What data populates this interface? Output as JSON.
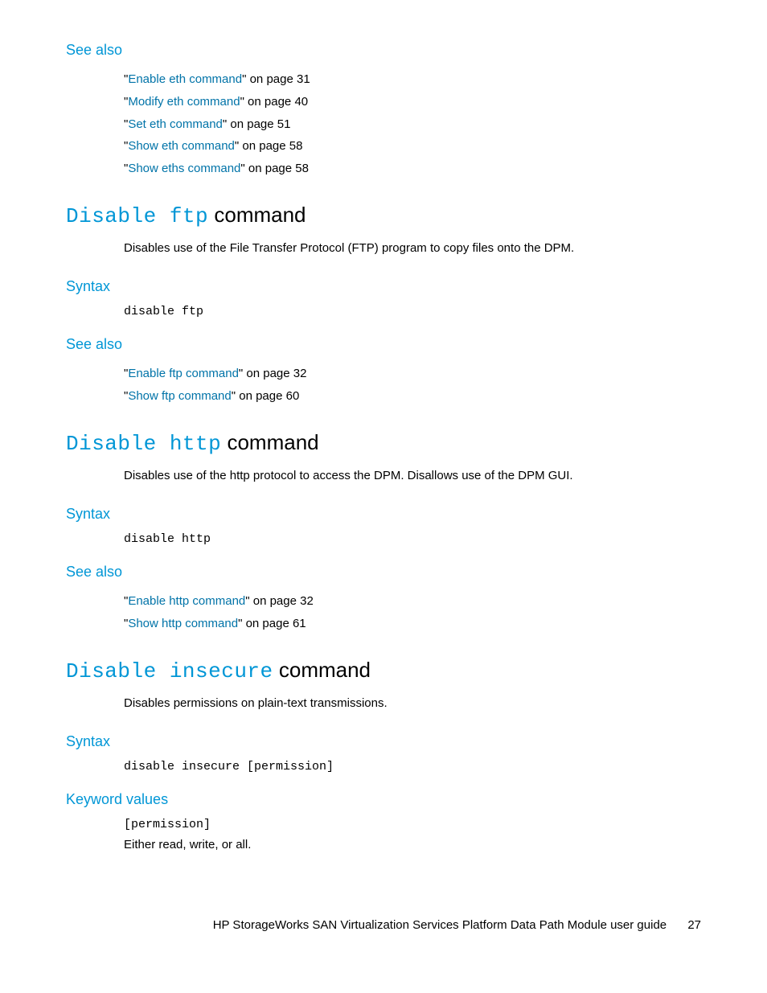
{
  "sec_eth": {
    "see_also_label": "See also",
    "refs": [
      {
        "link": "Enable eth command",
        "suffix": "\" on page 31"
      },
      {
        "link": "Modify eth command",
        "suffix": "\" on page 40"
      },
      {
        "link": "Set eth command",
        "suffix": "\" on page 51"
      },
      {
        "link": "Show eth command",
        "suffix": "\" on page 58"
      },
      {
        "link": "Show eths command",
        "suffix": "\" on page 58"
      }
    ]
  },
  "sec_ftp": {
    "title_mono": "Disable ftp",
    "title_rest": " command",
    "desc": "Disables use of the File Transfer Protocol (FTP) program to copy files onto the DPM.",
    "syntax_label": "Syntax",
    "syntax_code": "disable ftp",
    "see_also_label": "See also",
    "refs": [
      {
        "link": "Enable ftp command",
        "suffix": "\" on page 32"
      },
      {
        "link": "Show ftp command",
        "suffix": "\" on page 60"
      }
    ]
  },
  "sec_http": {
    "title_mono": "Disable http",
    "title_rest": " command",
    "desc": "Disables use of the http protocol to access the DPM. Disallows use of the DPM GUI.",
    "syntax_label": "Syntax",
    "syntax_code": "disable http",
    "see_also_label": "See also",
    "refs": [
      {
        "link": "Enable http command",
        "suffix": "\" on page 32"
      },
      {
        "link": "Show http command",
        "suffix": "\" on page 61"
      }
    ]
  },
  "sec_insecure": {
    "title_mono": "Disable insecure",
    "title_rest": " command",
    "desc": "Disables permissions on plain-text transmissions.",
    "syntax_label": "Syntax",
    "syntax_code": "disable insecure [permission]",
    "kv_label": "Keyword values",
    "kv_key": "[permission]",
    "kv_desc": "Either read, write, or all."
  },
  "footer": {
    "text": "HP StorageWorks SAN Virtualization Services Platform Data Path Module user guide",
    "page": "27"
  },
  "quote": "\""
}
